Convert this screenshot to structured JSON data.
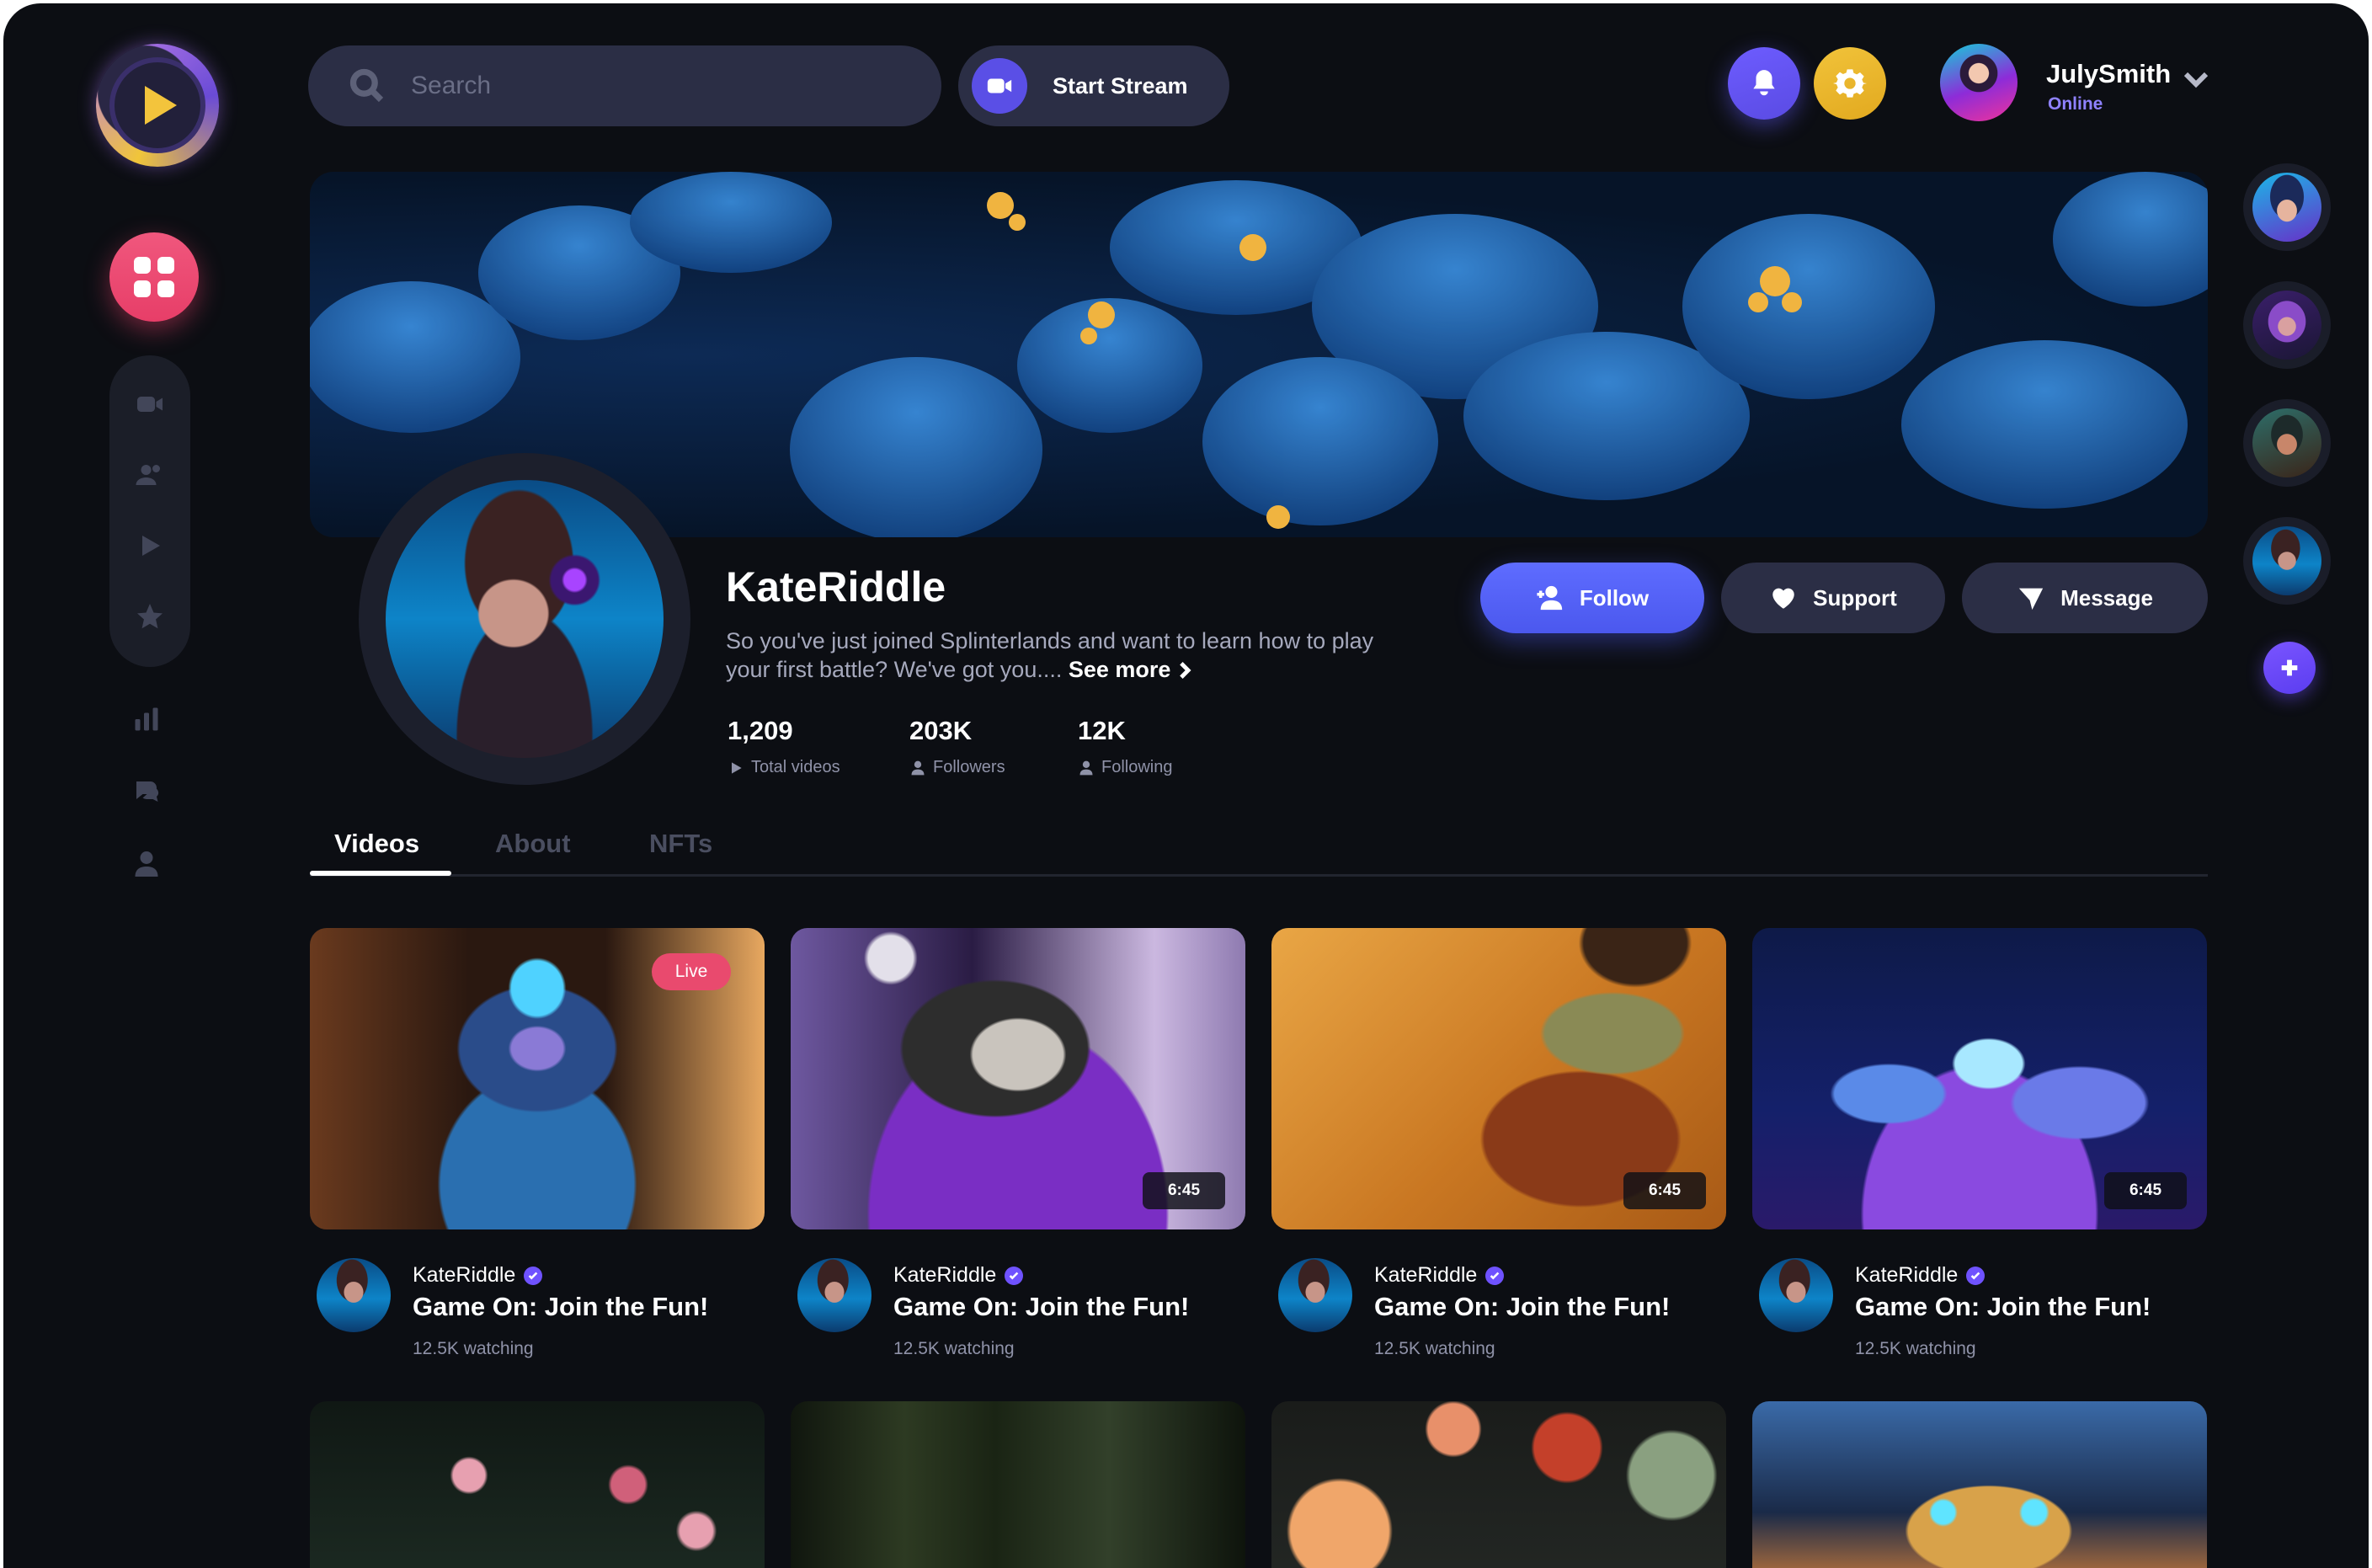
{
  "search": {
    "placeholder": "Search"
  },
  "header": {
    "start_stream_label": "Start Stream",
    "user": {
      "name": "JulySmith",
      "status": "Online"
    }
  },
  "profile": {
    "name": "KateRiddle",
    "bio": "So you've just joined Splinterlands and want to learn how to play your first battle? We've got you....",
    "see_more": "See more",
    "stats": [
      {
        "value": "1,209",
        "label": "Total videos",
        "icon": "play-icon"
      },
      {
        "value": "203K",
        "label": "Followers",
        "icon": "user-icon"
      },
      {
        "value": "12K",
        "label": "Following",
        "icon": "user-icon"
      }
    ],
    "actions": {
      "follow": "Follow",
      "support": "Support",
      "message": "Message"
    }
  },
  "tabs": [
    {
      "label": "Videos",
      "active": true
    },
    {
      "label": "About",
      "active": false
    },
    {
      "label": "NFTs",
      "active": false
    }
  ],
  "videos": [
    {
      "channel": "KateRiddle",
      "title": "Game On: Join the Fun!",
      "watching": "12.5K watching",
      "badge": "Live",
      "thumb": "robot"
    },
    {
      "channel": "KateRiddle",
      "title": "Game On: Join the Fun!",
      "watching": "12.5K watching",
      "duration": "6:45",
      "thumb": "purple"
    },
    {
      "channel": "KateRiddle",
      "title": "Game On: Join the Fun!",
      "watching": "12.5K watching",
      "duration": "6:45",
      "thumb": "map"
    },
    {
      "channel": "KateRiddle",
      "title": "Game On: Join the Fun!",
      "watching": "12.5K watching",
      "duration": "6:45",
      "thumb": "crystal"
    }
  ],
  "colors": {
    "background": "#0c0e13",
    "accent_blue": "#5563f6",
    "accent_pink": "#e94a6e",
    "accent_yellow": "#f1c33a",
    "accent_purple": "#6f52ff",
    "surface": "#2b2e45"
  }
}
